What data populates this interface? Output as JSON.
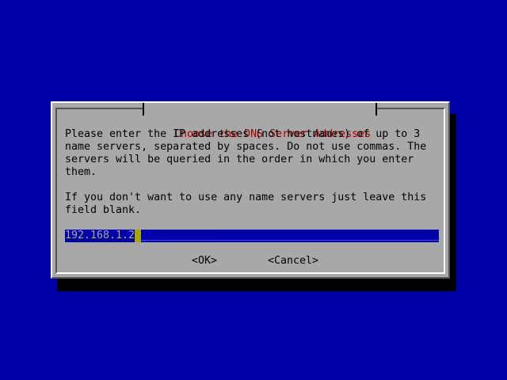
{
  "colors": {
    "desktop": "#0000a8",
    "dialog": "#a8a8a8",
    "text": "#000000",
    "title_text": "#a80000",
    "field_bg": "#0000a8",
    "field_text": "#a8a8a8",
    "cursor": "#a8a800"
  },
  "dialog": {
    "title": "Choose the DNS Server Addresses",
    "paragraph1": "Please enter the IP addresses (not hostnames) of up to 3\nname servers, separated by spaces. Do not use commas. The\nservers will be queried in the order in which you enter\nthem.",
    "paragraph2": "If you don't want to use any name servers just leave this\nfield blank."
  },
  "field": {
    "value": "192.168.1.2",
    "padding": "__________________________________________________"
  },
  "buttons": {
    "ok_label": "<OK>",
    "cancel_label": "<Cancel>"
  }
}
